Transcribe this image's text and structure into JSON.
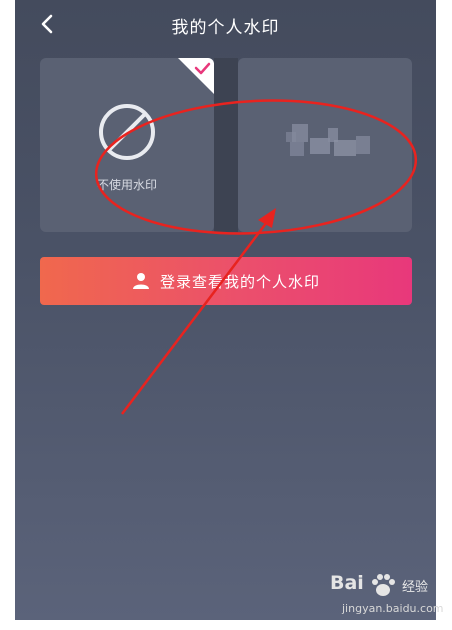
{
  "header": {
    "title": "我的个人水印",
    "back_icon": "chevron-left-icon"
  },
  "watermark_options": [
    {
      "label": "不使用水印",
      "icon": "no-sign-icon",
      "selected": true
    },
    {
      "label": "",
      "icon": "blurred-preview",
      "selected": false
    }
  ],
  "login_button": {
    "label": "登录查看我的个人水印",
    "icon": "person-icon"
  },
  "site_watermark": {
    "logo": "Bai",
    "name": "经验",
    "url": "jingyan.baidu.com"
  },
  "colors": {
    "background_top": "#444b5d",
    "background_bottom": "#5b637a",
    "card": "#5a6173",
    "button_start": "#f0684d",
    "button_end": "#e8387b",
    "annotation": "#e8231f"
  }
}
